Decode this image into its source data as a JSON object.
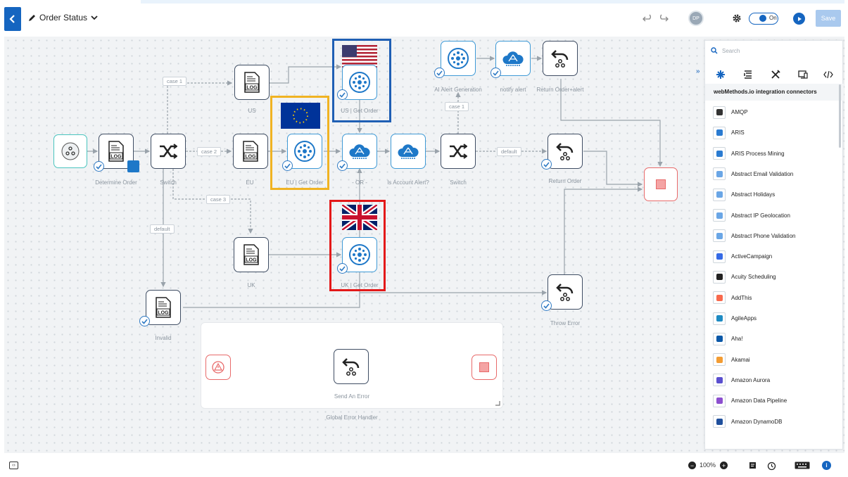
{
  "toolbar": {
    "title": "Order Status",
    "toggle_label": "On",
    "save_label": "Save",
    "avatar_initials": "DP",
    "accent_color": "#1565c0"
  },
  "flow": {
    "nodes": {
      "determine_order": "Determine Order",
      "switch1": "Switch",
      "us_log": "US",
      "eu_log": "EU",
      "uk_log": "UK",
      "us_get_order": "US | Get Order",
      "eu_get_order": "EU | Get Order",
      "uk_get_order": "UK | Get Order",
      "or": "- OR -",
      "is_account_alert": "Is Account Alert?",
      "switch2": "Switch",
      "ai_alert": "AI Alert Generation",
      "notify_alert": "notify alert",
      "return_order_alert": "Return Order+alert",
      "return_order": "Return Order",
      "invalid": "Invalid",
      "throw_error": "Throw Error",
      "send_error": "Send An Error"
    },
    "edges": {
      "case1": "case 1",
      "case2": "case 2",
      "case3": "case 3",
      "default1": "default",
      "default2": "default",
      "case1b": "case 1"
    },
    "log_text": "LOG",
    "handler_title": "Global Error Handler",
    "highlight_colors": {
      "us": "#1f5fb4",
      "eu": "#f0b323",
      "uk": "#e31919"
    }
  },
  "panel": {
    "search_placeholder": "Search",
    "title": "webMethods.io integration connectors",
    "connectors": [
      {
        "name": "AMQP",
        "icon": "amqp-icon",
        "color": "#333333"
      },
      {
        "name": "ARIS",
        "icon": "aris-icon",
        "color": "#2a7bd1"
      },
      {
        "name": "ARIS Process Mining",
        "icon": "aris-icon",
        "color": "#2a7bd1"
      },
      {
        "name": "Abstract Email Validation",
        "icon": "abstract-icon",
        "color": "#6aa6e6"
      },
      {
        "name": "Abstract Holidays",
        "icon": "abstract-icon",
        "color": "#6aa6e6"
      },
      {
        "name": "Abstract IP Geolocation",
        "icon": "abstract-icon",
        "color": "#6aa6e6"
      },
      {
        "name": "Abstract Phone Validation",
        "icon": "abstract-icon",
        "color": "#6aa6e6"
      },
      {
        "name": "ActiveCampaign",
        "icon": "activecampaign-icon",
        "color": "#356ae6"
      },
      {
        "name": "Acuity Scheduling",
        "icon": "acuity-icon",
        "color": "#222222"
      },
      {
        "name": "AddThis",
        "icon": "addthis-icon",
        "color": "#f8694d"
      },
      {
        "name": "AgileApps",
        "icon": "agileapps-icon",
        "color": "#1e8bc3"
      },
      {
        "name": "Aha!",
        "icon": "aha-icon",
        "color": "#0a58a8"
      },
      {
        "name": "Akamai",
        "icon": "akamai-icon",
        "color": "#f39c33"
      },
      {
        "name": "Amazon Aurora",
        "icon": "aurora-icon",
        "color": "#5a4fcf"
      },
      {
        "name": "Amazon Data Pipeline",
        "icon": "datapipeline-icon",
        "color": "#8c4fcf"
      },
      {
        "name": "Amazon DynamoDB",
        "icon": "dynamodb-icon",
        "color": "#1f4f9c"
      }
    ]
  },
  "footer": {
    "zoom": "100%"
  }
}
